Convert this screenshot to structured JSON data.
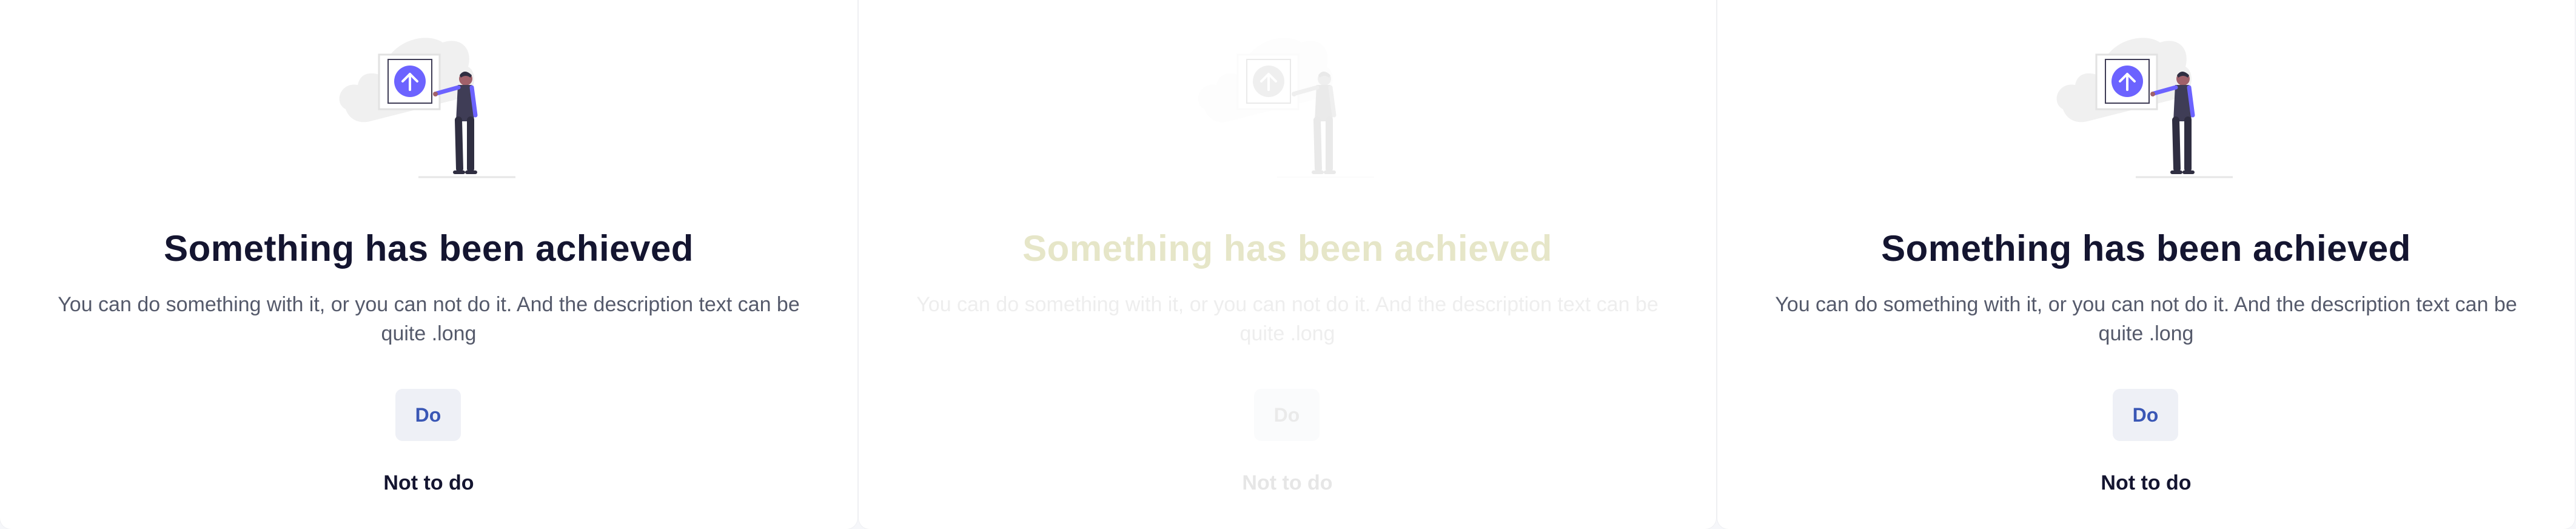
{
  "panels": [
    {
      "state": "normal",
      "title": "Something has been achieved",
      "description": "You can do something with it, or you can not do it. And the description text can be quite .long",
      "primary_label": "Do",
      "secondary_label": "Not to do",
      "illustration": "person-presenting-upload-icon"
    },
    {
      "state": "faded",
      "title": "Something has been achieved",
      "description": "You can do something with it, or you can not do it. And the description text can be quite .long",
      "primary_label": "Do",
      "secondary_label": "Not to do",
      "illustration": "person-presenting-upload-icon"
    },
    {
      "state": "normal",
      "title": "Something has been achieved",
      "description": "You can do something with it, or you can not do it. And the description text can be quite .long",
      "primary_label": "Do",
      "secondary_label": "Not to do",
      "illustration": "person-presenting-upload-icon"
    }
  ],
  "colors": {
    "accent": "#6c63ff",
    "title": "#141530",
    "link_button": "#3a57b5",
    "button_bg": "#eef0f6"
  }
}
